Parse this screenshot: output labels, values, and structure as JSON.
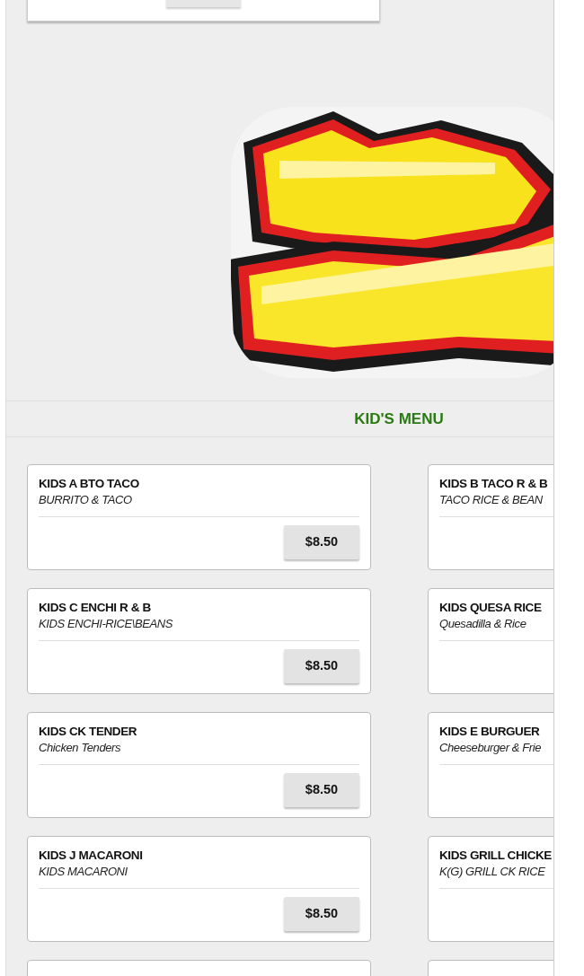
{
  "section": {
    "title": "KID'S MENU"
  },
  "items": [
    {
      "title": "KIDS A BTO TACO",
      "subtitle": "BURRITO & TACO",
      "price": "$8.50"
    },
    {
      "title": "KIDS B TACO R & B",
      "subtitle": "TACO RICE & BEAN"
    },
    {
      "title": "KIDS C ENCHI R & B",
      "subtitle": "KIDS ENCHI-RICE\\BEANS",
      "price": "$8.50"
    },
    {
      "title": "KIDS QUESA RICE",
      "subtitle": "Quesadilla & Rice"
    },
    {
      "title": "KIDS CK TENDER",
      "subtitle": "Chicken Tenders",
      "price": "$8.50"
    },
    {
      "title": "KIDS E BURGUER",
      "subtitle": "Cheeseburger & Frie"
    },
    {
      "title": "KIDS J MACARONI",
      "subtitle": "KIDS MACARONI",
      "price": "$8.50"
    },
    {
      "title": "KIDS GRILL CHICKE",
      "subtitle": "K(G) GRILL CK RICE"
    }
  ]
}
